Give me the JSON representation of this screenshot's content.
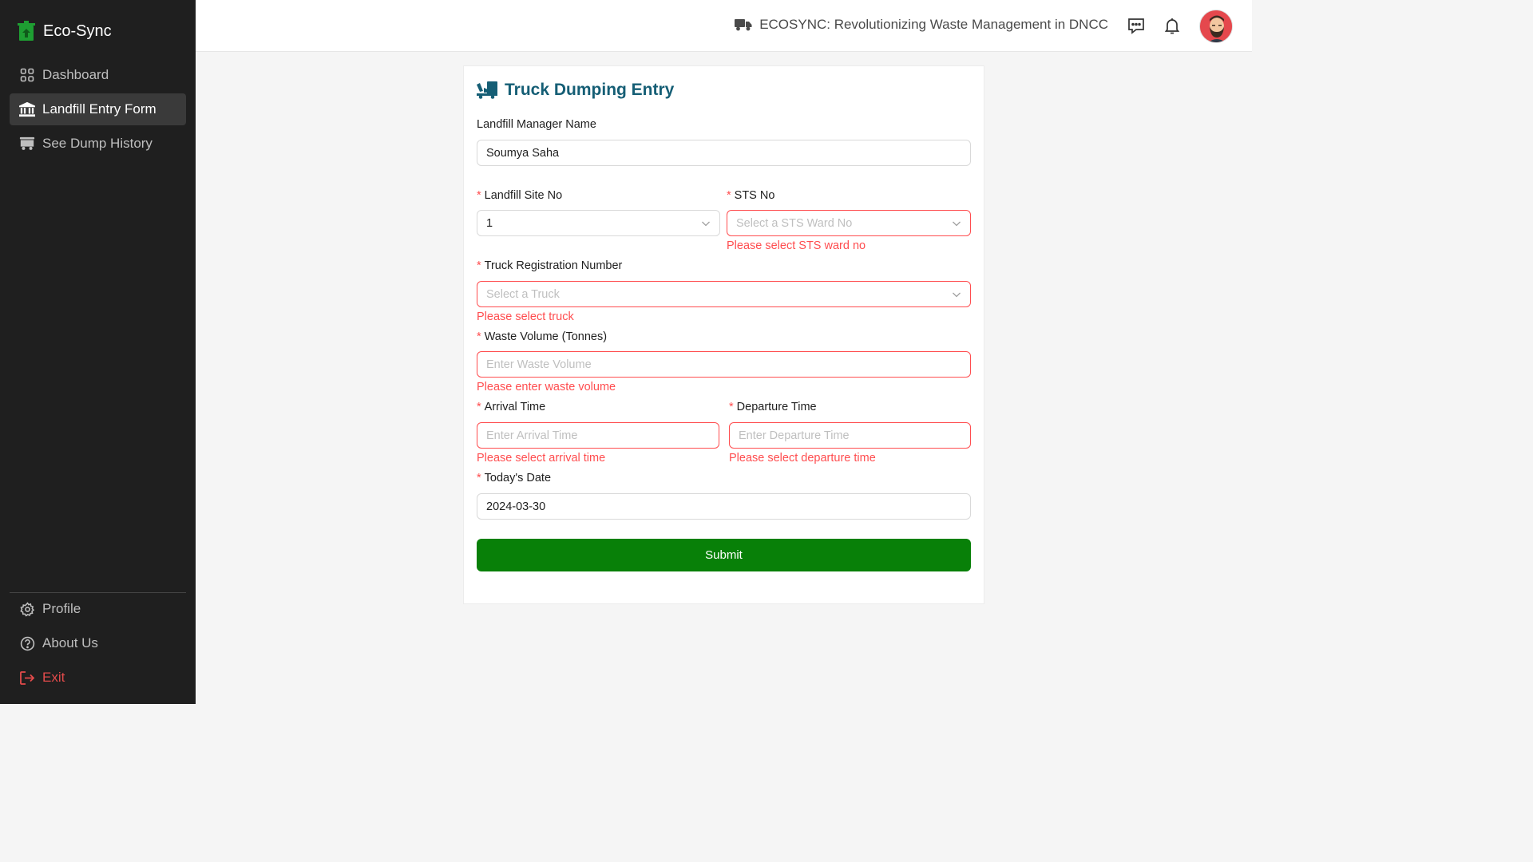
{
  "app": {
    "name": "Eco-Sync",
    "header_title": "ECOSYNC: Revolutionizing Waste Management in DNCC",
    "accent": "#088008",
    "error_color": "#ff4d4f",
    "title_color": "#155e75"
  },
  "sidebar": {
    "items": [
      {
        "label": "Dashboard",
        "icon": "grid-icon"
      },
      {
        "label": "Landfill Entry Form",
        "icon": "bank-icon",
        "active": true
      },
      {
        "label": "See Dump History",
        "icon": "truck-history-icon"
      }
    ],
    "bottom_items": [
      {
        "label": "Profile",
        "icon": "gear-icon"
      },
      {
        "label": "About Us",
        "icon": "question-circle-icon"
      },
      {
        "label": "Exit",
        "icon": "logout-icon"
      }
    ]
  },
  "form": {
    "title": "Truck Dumping Entry",
    "manager": {
      "label": "Landfill Manager Name",
      "value": "Soumya Saha"
    },
    "landfill_site": {
      "label": "Landfill Site No",
      "value": "1"
    },
    "sts": {
      "label": "STS No",
      "placeholder": "Select a STS Ward No",
      "error": "Please select STS ward no"
    },
    "truck": {
      "label": "Truck Registration Number",
      "placeholder": "Select a Truck",
      "error": "Please select truck"
    },
    "waste_volume": {
      "label": "Waste Volume (Tonnes)",
      "placeholder": "Enter Waste Volume",
      "error": "Please enter waste volume"
    },
    "arrival": {
      "label": "Arrival Time",
      "placeholder": "Enter Arrival Time",
      "error": "Please select arrival time"
    },
    "departure": {
      "label": "Departure Time",
      "placeholder": "Enter Departure Time",
      "error": "Please select departure time"
    },
    "date": {
      "label": "Today's Date",
      "value": "2024-03-30"
    },
    "submit_label": "Submit"
  }
}
